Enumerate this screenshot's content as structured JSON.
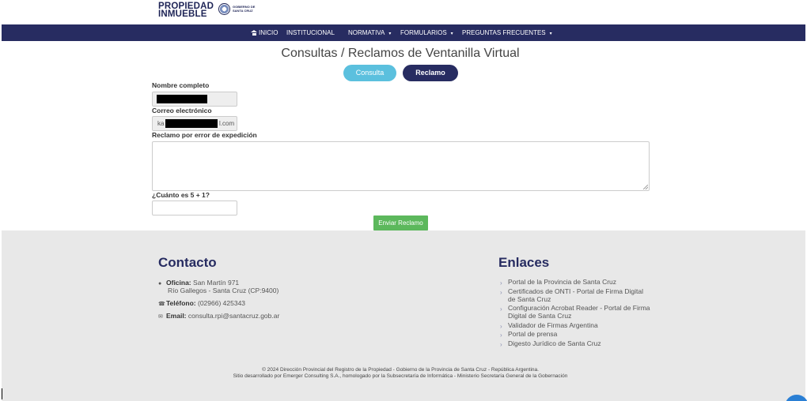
{
  "brand": {
    "logo_line1": "PROPIEDAD",
    "logo_line2": "INMUEBLE",
    "gov_line1": "GOBIERNO DE",
    "gov_line2": "SANTA CRUZ"
  },
  "nav": {
    "items": [
      {
        "label": "INICIO",
        "icon": "home-icon"
      },
      {
        "label": "INSTITUCIONAL"
      },
      {
        "label": "NORMATIVA",
        "dropdown": true
      },
      {
        "label": "FORMULARIOS",
        "dropdown": true
      },
      {
        "label": "PREGUNTAS FRECUENTES",
        "dropdown": true
      }
    ],
    "caret": "▾"
  },
  "main": {
    "title": "Consultas / Reclamos de Ventanilla Virtual",
    "tabs": [
      {
        "label": "Consulta",
        "color": "#5bc0de"
      },
      {
        "label": "Reclamo",
        "color": "#272c61",
        "active": true
      }
    ],
    "form": {
      "name_label": "Nombre completo",
      "name_value": "",
      "email_label": "Correo electrónico",
      "email_prefix": "ka",
      "email_suffix": "l.com",
      "reclamo_label": "Reclamo por error de expedición",
      "reclamo_value": "",
      "captcha_label": "¿Cuánto es 5 + 1?",
      "captcha_value": "",
      "submit_label": "Enviar Reclamo",
      "submit_color": "#5cb85c"
    }
  },
  "footer": {
    "contact": {
      "heading": "Contacto",
      "office_label": "Oficina:",
      "office_value": "San Martín 971",
      "office_line2": "Río Gallegos - Santa Cruz (CP:9400)",
      "phone_label": "Teléfono:",
      "phone_value": "(02966) 425343",
      "email_label": "Email:",
      "email_value": "consulta.rpi@santacruz.gob.ar"
    },
    "links": {
      "heading": "Enlaces",
      "items": [
        {
          "line1": "Portal de la Provincia de Santa Cruz",
          "line2": ""
        },
        {
          "line1": "Certificados de ONTI - Portal de Firma Digital",
          "line2": "de Santa Cruz"
        },
        {
          "line1": "Configuración Acrobat Reader - Portal de Firma",
          "line2": "Digital de Santa Cruz"
        },
        {
          "line1": "Validador de Firmas Argentina",
          "line2": ""
        },
        {
          "line1": "Portal de prensa",
          "line2": ""
        },
        {
          "line1": "Digesto Jurídico de Santa Cruz",
          "line2": ""
        }
      ]
    },
    "copyright_line1": "© 2024 Dirección Provincial del Registro de la Propiedad - Gobierno de la Provincia de Santa Cruz - República Argentina.",
    "copyright_line2": "Sitio desarrollado por Emerger Consulting S.A., homologado por la Subsecretaría de Informática - Ministerio Secretaría General de la Gobernación"
  },
  "colors": {
    "navy": "#272c61",
    "footer_bg": "#e8e8e8"
  }
}
